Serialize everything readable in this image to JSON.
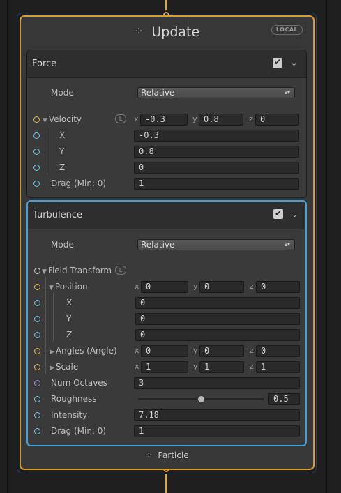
{
  "context": {
    "title": "Update",
    "title_icon": "vfx-dots-icon",
    "badge": "LOCAL",
    "footer_label": "Particle",
    "accent_color": "#d89f2a",
    "selected_color": "#3fa3e0"
  },
  "force": {
    "title": "Force",
    "mode_label": "Mode",
    "mode_value": "Relative",
    "velocity_label": "Velocity",
    "space_badge": "L",
    "velocity": {
      "x": "-0.3",
      "y": "0.8",
      "z": "0"
    },
    "axis_labels": {
      "x": "x",
      "y": "y",
      "z": "z"
    },
    "x_label": "X",
    "y_label": "Y",
    "z_label": "Z",
    "x_value": "-0.3",
    "y_value": "0.8",
    "z_value": "0",
    "drag_label": "Drag (Min: 0)",
    "drag_value": "1",
    "enabled": true
  },
  "turbulence": {
    "title": "Turbulence",
    "mode_label": "Mode",
    "mode_value": "Relative",
    "field_transform_label": "Field Transform",
    "space_badge": "L",
    "position_label": "Position",
    "position": {
      "x": "0",
      "y": "0",
      "z": "0"
    },
    "px_label": "X",
    "px_value": "0",
    "py_label": "Y",
    "py_value": "0",
    "pz_label": "Z",
    "pz_value": "0",
    "angles_label": "Angles (Angle)",
    "angles": {
      "x": "0",
      "y": "0",
      "z": "0"
    },
    "scale_label": "Scale",
    "scale": {
      "x": "1",
      "y": "1",
      "z": "1"
    },
    "num_octaves_label": "Num Octaves",
    "num_octaves_value": "3",
    "roughness_label": "Roughness",
    "roughness_value": "0.5",
    "roughness_fraction": 0.5,
    "intensity_label": "Intensity",
    "intensity_value": "7.18",
    "drag_label": "Drag (Min: 0)",
    "drag_value": "1",
    "enabled": true
  }
}
